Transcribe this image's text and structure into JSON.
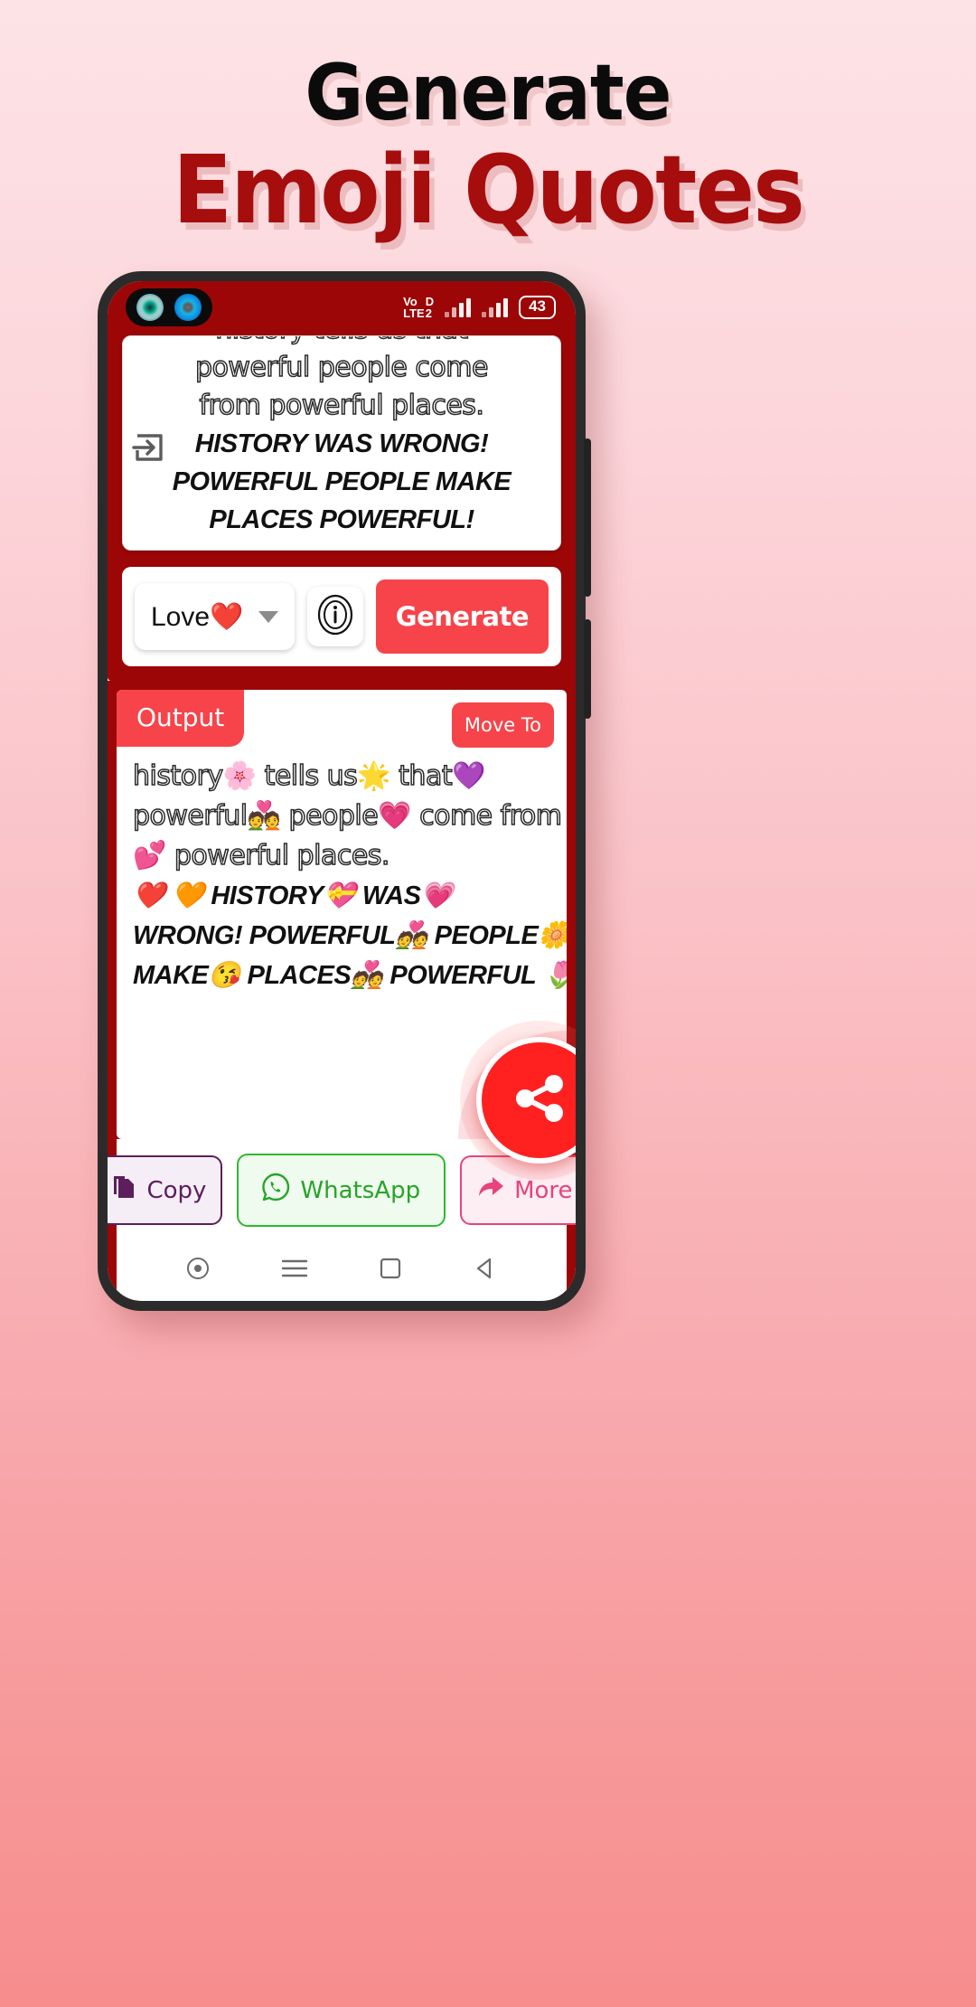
{
  "headline": {
    "line1": "Generate",
    "line2": "Emoji Quotes",
    "line1_color": "#0b0b0b",
    "line2_color": "#a60d0d"
  },
  "phone": {
    "statusbar": {
      "network_label_top": "Vo",
      "network_label_bottom": "LTE",
      "sim_label_top": "D",
      "sim_label_bottom": "2",
      "battery": "43"
    },
    "input_card": {
      "enter_icon": "enter-arrow-icon",
      "lines": [
        {
          "text": "history tells us that",
          "style": "outline"
        },
        {
          "text": "powerful people come",
          "style": "outline"
        },
        {
          "text": "from powerful places.",
          "style": "outline"
        },
        {
          "text": "HISTORY WAS WRONG!",
          "style": "bolditalic"
        },
        {
          "text": "POWERFUL PEOPLE MAKE",
          "style": "bolditalic"
        },
        {
          "text": "PLACES POWERFUL!",
          "style": "bolditalic"
        }
      ]
    },
    "controls": {
      "category_value": "Love❤️",
      "category_caret": "chevron-down-icon",
      "info_icon": "info-circle-icon",
      "generate_label": "Generate"
    },
    "output": {
      "badge": "Output",
      "move_to_label": "Move To",
      "lines": [
        "history🌸 tells us🌟 that💜",
        "powerful💑 people💗 come from",
        "💕 powerful places.",
        "❤️ 🧡 HISTORY💝 WAS💗",
        "WRONG! POWERFUL💑 PEOPLE🌼",
        "MAKE😘 PLACES💑 POWERFUL 🌷"
      ],
      "share_fab_icon": "share-icon"
    },
    "actions": [
      {
        "label": "Copy",
        "icon": "copy-icon",
        "color": "#5c1e5c"
      },
      {
        "label": "WhatsApp",
        "icon": "whatsapp-icon",
        "color": "#2aa32a"
      },
      {
        "label": "More",
        "icon": "share-arrow-icon",
        "color": "#e8437c"
      }
    ],
    "navbar": [
      {
        "icon": "dot-circle-icon"
      },
      {
        "icon": "menu-lines-icon"
      },
      {
        "icon": "home-square-icon"
      },
      {
        "icon": "back-triangle-icon"
      }
    ]
  }
}
